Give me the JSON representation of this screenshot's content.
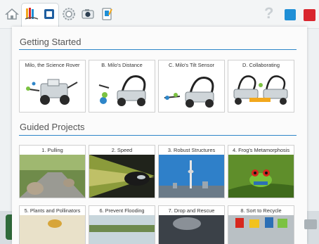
{
  "toolbar": {
    "icons": [
      "home-icon",
      "book-icon",
      "tab-icon",
      "gear-icon",
      "camera-icon",
      "document-icon",
      "help-icon",
      "blue-square-icon",
      "red-square-icon"
    ],
    "help_label": "?",
    "colors": {
      "blue": "#1f8fd6",
      "red": "#d9262e"
    }
  },
  "getting_started": {
    "title": "Getting Started",
    "items": [
      {
        "label": "Milo, the Science Rover"
      },
      {
        "label": "B. Milo's Distance"
      },
      {
        "label": "C. Milo's Tilt Sensor"
      },
      {
        "label": "D. Collaborating"
      }
    ]
  },
  "guided_projects": {
    "title": "Guided Projects",
    "items": [
      {
        "label": "1. Pulling"
      },
      {
        "label": "2. Speed"
      },
      {
        "label": "3. Robust Structures"
      },
      {
        "label": "4. Frog's Metamorphosis"
      },
      {
        "label": "5. Plants and Pollinators"
      },
      {
        "label": "6. Prevent Flooding"
      },
      {
        "label": "7. Drop and Rescue"
      },
      {
        "label": "8. Sort to Recycle"
      }
    ]
  },
  "accent_color": "#2e86c9"
}
